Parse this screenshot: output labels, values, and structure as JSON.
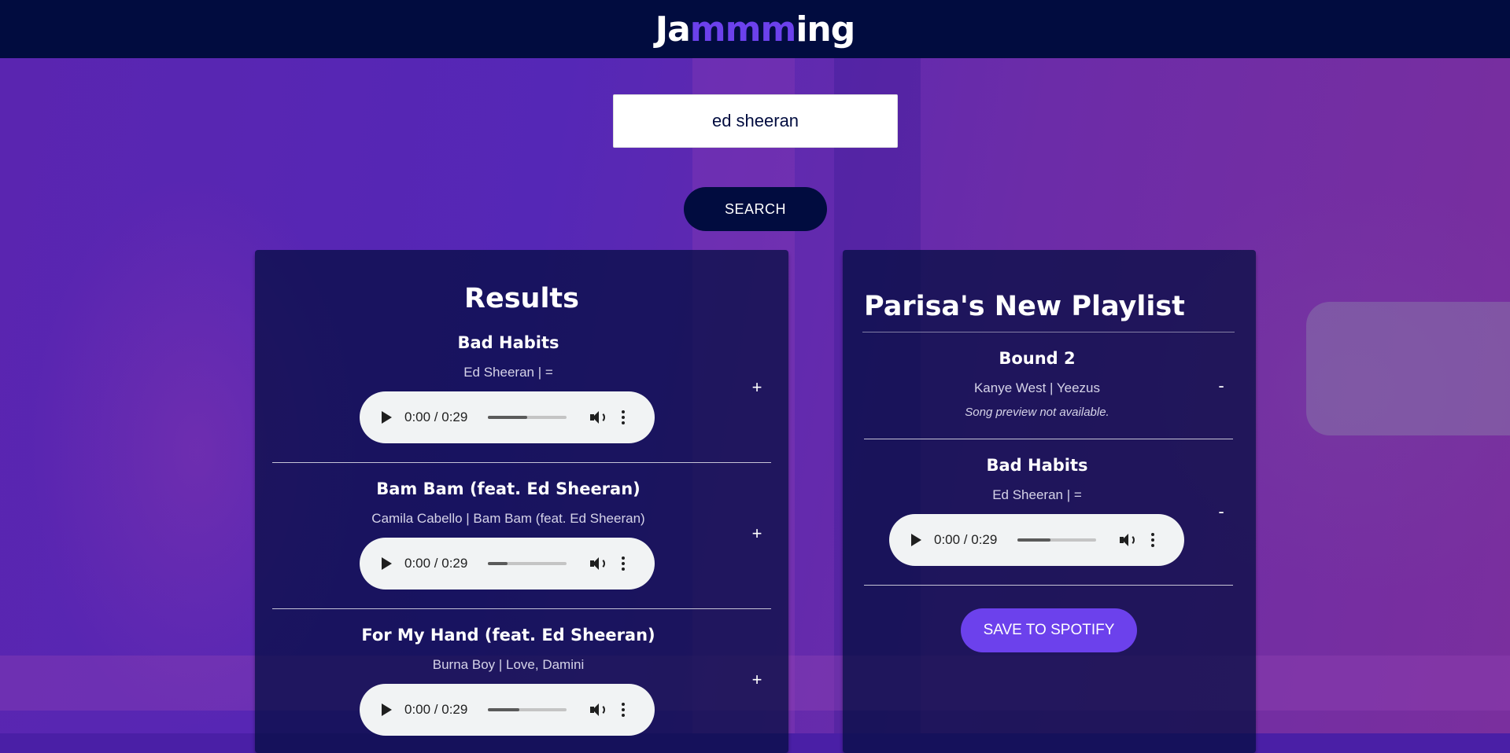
{
  "app": {
    "logo_prefix": "Ja",
    "logo_highlight": "mmm",
    "logo_suffix": "ing",
    "accent_color": "#6c41ec",
    "header_color": "#010c3f"
  },
  "search": {
    "value": "ed sheeran",
    "button_label": "SEARCH"
  },
  "results": {
    "title": "Results",
    "tracks": [
      {
        "name": "Bad Habits",
        "meta": "Ed Sheeran | =",
        "time": "0:00 / 0:29",
        "progress": 0.5,
        "action": "+"
      },
      {
        "name": "Bam Bam (feat. Ed Sheeran)",
        "meta": "Camila Cabello | Bam Bam (feat. Ed Sheeran)",
        "time": "0:00 / 0:29",
        "progress": 0.25,
        "action": "+"
      },
      {
        "name": "For My Hand (feat. Ed Sheeran)",
        "meta": "Burna Boy | Love, Damini",
        "time": "0:00 / 0:29",
        "progress": 0.4,
        "action": "+"
      }
    ]
  },
  "playlist": {
    "title": "Parisa's New Playlist",
    "tracks": [
      {
        "name": "Bound 2",
        "meta": "Kanye West | Yeezus",
        "note": "Song preview not available.",
        "action": "-"
      },
      {
        "name": "Bad Habits",
        "meta": "Ed Sheeran | =",
        "time": "0:00 / 0:29",
        "progress": 0.42,
        "action": "-"
      }
    ],
    "save_label": "SAVE TO SPOTIFY"
  }
}
